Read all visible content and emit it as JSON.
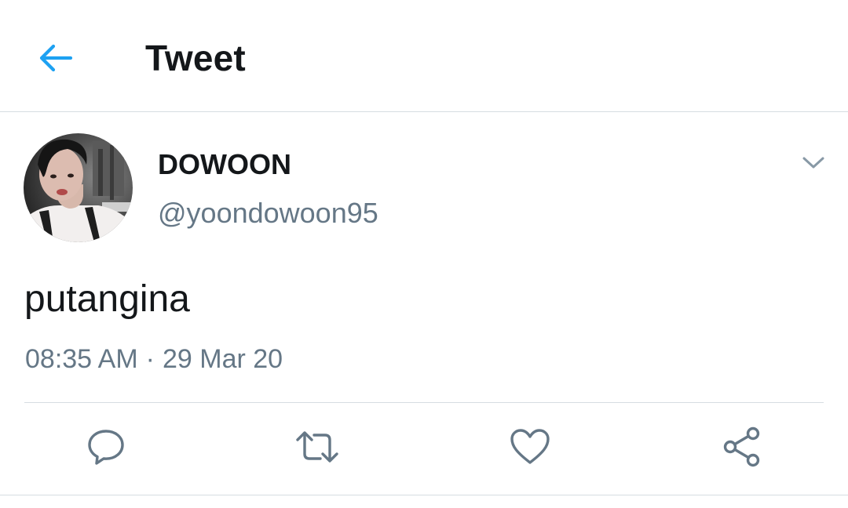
{
  "header": {
    "title": "Tweet",
    "back_icon": "arrow-left-icon",
    "accent_color": "#1da1f2"
  },
  "tweet": {
    "author": {
      "display_name": "DOWOON",
      "handle": "@yoondowoon95"
    },
    "text": "putangina",
    "time": "08:35 AM",
    "separator": "·",
    "date": "29 Mar 20"
  },
  "actions": {
    "reply_icon": "reply-bubble-icon",
    "retweet_icon": "retweet-icon",
    "like_icon": "heart-icon",
    "share_icon": "share-icon"
  },
  "colors": {
    "text_primary": "#14171a",
    "text_secondary": "#657786",
    "divider": "#d6dde2",
    "icon_gray": "#657786"
  }
}
